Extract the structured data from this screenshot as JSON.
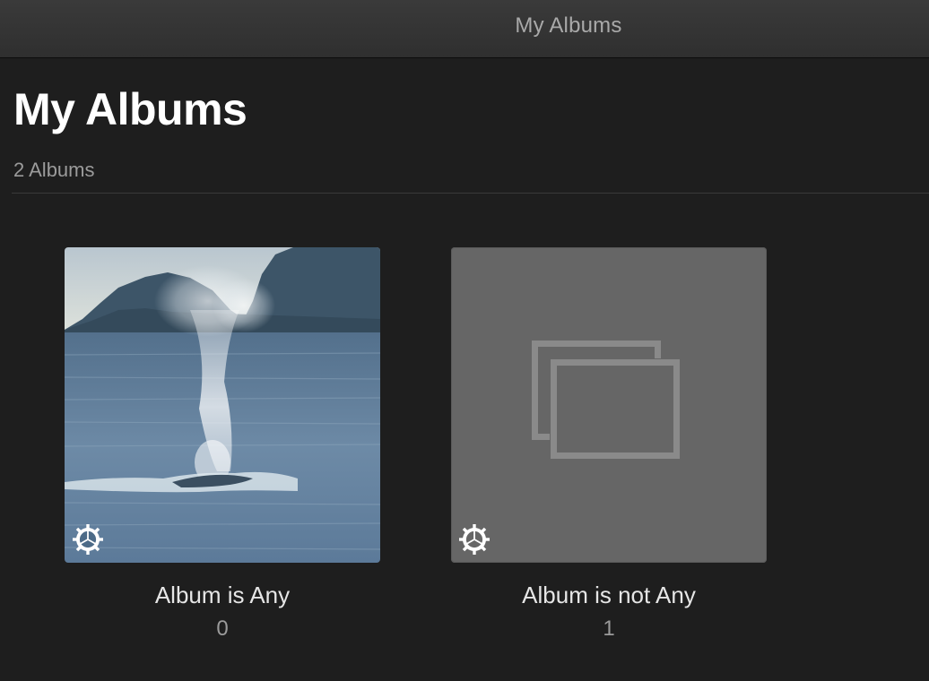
{
  "window": {
    "title": "My Albums"
  },
  "page": {
    "title": "My Albums",
    "count_label": "2 Albums"
  },
  "albums": [
    {
      "name": "Album is Any",
      "count": "0",
      "thumbnail": "whale-spout-photo",
      "settings_icon": "gear-icon"
    },
    {
      "name": "Album is not Any",
      "count": "1",
      "thumbnail": "empty-album-placeholder-icon",
      "settings_icon": "gear-icon"
    }
  ],
  "colors": {
    "background": "#1e1e1e",
    "titlebar": "#333333",
    "placeholder": "#666666",
    "secondary_text": "#9b9b9b"
  }
}
